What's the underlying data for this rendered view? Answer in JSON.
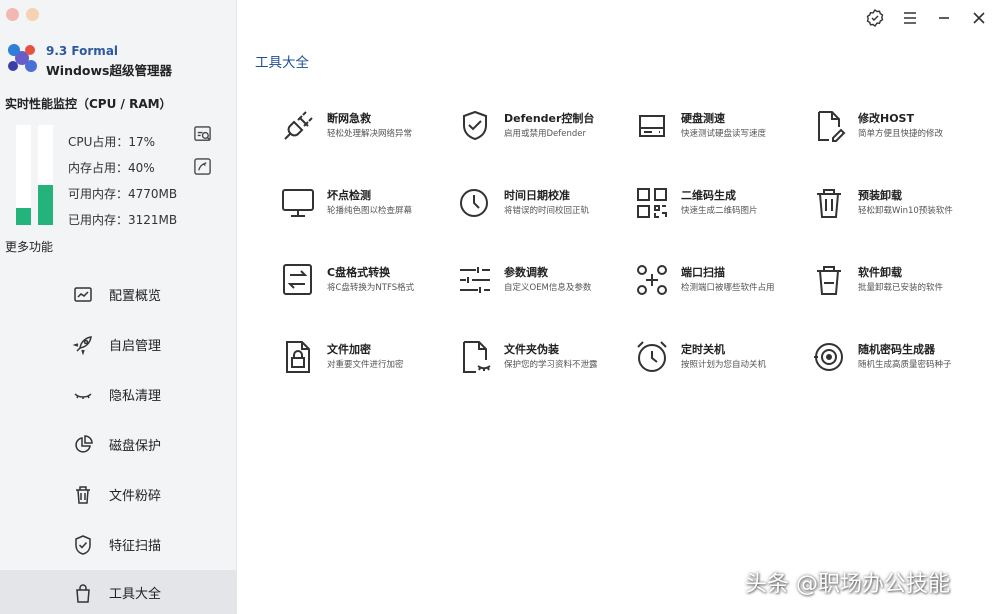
{
  "app": {
    "version": "9.3 Formal",
    "name": "Windows超级管理器"
  },
  "monitor": {
    "title": "实时性能监控（CPU / RAM）",
    "cpu_label": "CPU占用：17%",
    "mem_label": "内存占用：40%",
    "avail_label": "可用内存：4770MB",
    "used_label": "已用内存：3121MB",
    "cpu_percent": 17,
    "mem_percent": 40
  },
  "sidebar": {
    "more_label": "更多功能",
    "items": [
      {
        "label": "配置概览",
        "icon": "chart-icon"
      },
      {
        "label": "自启管理",
        "icon": "rocket-icon"
      },
      {
        "label": "隐私清理",
        "icon": "closed-eye-icon"
      },
      {
        "label": "磁盘保护",
        "icon": "pie-chart-icon"
      },
      {
        "label": "文件粉碎",
        "icon": "trash-icon"
      },
      {
        "label": "特征扫描",
        "icon": "shield-check-icon"
      },
      {
        "label": "工具大全",
        "icon": "bag-icon"
      }
    ],
    "active_index": 6
  },
  "main": {
    "section_title": "工具大全",
    "tools": [
      {
        "name": "断网急救",
        "desc": "轻松处理解决网络异常",
        "icon": "plug-icon"
      },
      {
        "name": "Defender控制台",
        "desc": "启用或禁用Defender",
        "icon": "shield-icon"
      },
      {
        "name": "硬盘测速",
        "desc": "快速测试硬盘读写速度",
        "icon": "hard-drive-icon"
      },
      {
        "name": "修改HOST",
        "desc": "简单方便且快捷的修改",
        "icon": "file-edit-icon"
      },
      {
        "name": "坏点检测",
        "desc": "轮播纯色图以检查屏幕",
        "icon": "monitor-icon"
      },
      {
        "name": "时间日期校准",
        "desc": "将错误的时间校回正轨",
        "icon": "clock-icon"
      },
      {
        "name": "二维码生成",
        "desc": "快速生成二维码图片",
        "icon": "qr-code-icon"
      },
      {
        "name": "预装卸载",
        "desc": "轻松卸载Win10预装软件",
        "icon": "trash-icon"
      },
      {
        "name": "C盘格式转换",
        "desc": "将C盘转换为NTFS格式",
        "icon": "swap-icon"
      },
      {
        "name": "参数调教",
        "desc": "自定义OEM信息及参数",
        "icon": "sliders-icon"
      },
      {
        "name": "端口扫描",
        "desc": "检测端口被哪些软件占用",
        "icon": "scan-icon"
      },
      {
        "name": "软件卸载",
        "desc": "批量卸载已安装的软件",
        "icon": "trash-icon"
      },
      {
        "name": "文件加密",
        "desc": "对重要文件进行加密",
        "icon": "file-lock-icon"
      },
      {
        "name": "文件夹伪装",
        "desc": "保护您的学习资料不泄露",
        "icon": "file-disguise-icon"
      },
      {
        "name": "定时关机",
        "desc": "按照计划为您自动关机",
        "icon": "alarm-icon"
      },
      {
        "name": "随机密码生成器",
        "desc": "随机生成高质量密码种子",
        "icon": "target-icon"
      }
    ]
  },
  "watermark": "头条 @职场办公技能",
  "colors": {
    "accent": "#1d4f91",
    "bar_fill": "#25b37c",
    "sidebar_bg": "#f3f4f6",
    "active_bg": "#e4e5e8"
  }
}
